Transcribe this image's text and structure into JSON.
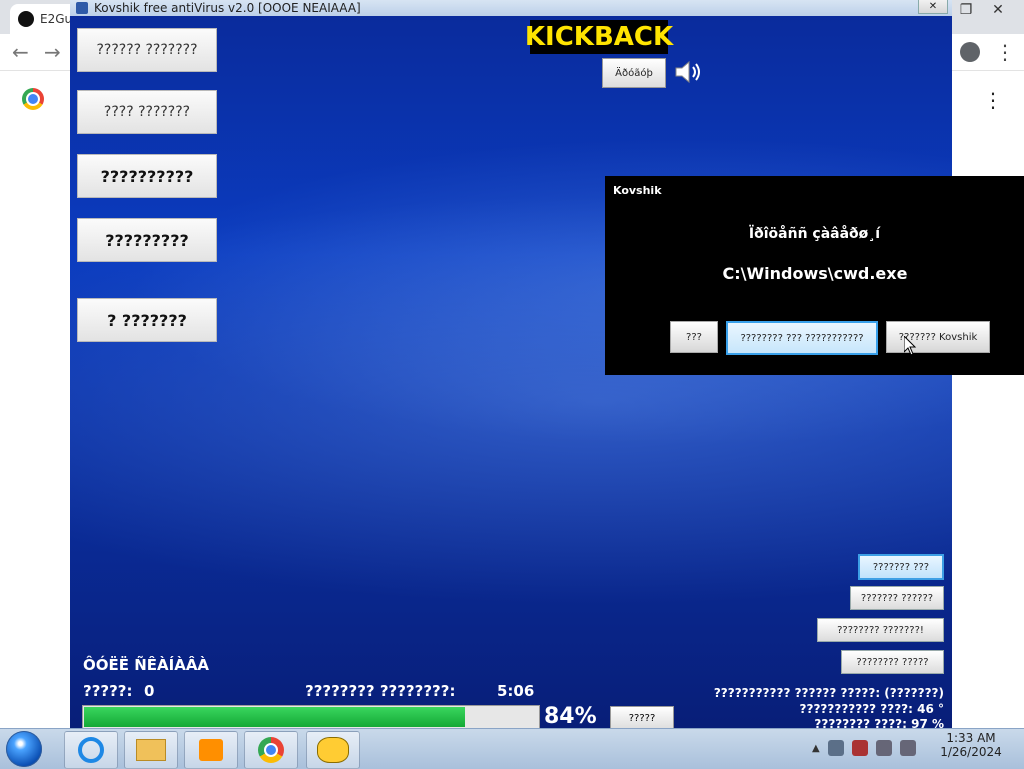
{
  "browser": {
    "tab_label": "E2Gu",
    "nav": {
      "back": "←",
      "forward": "→"
    }
  },
  "app": {
    "title": "Kovshik free antiVirus v2.0 [OOOE NEAIAAA]",
    "close_label": "✕",
    "menu_buttons": [
      "?????? ???????",
      "???? ???????",
      "??????????",
      "?????????",
      "? ???????"
    ],
    "kickback": "KICKBACK",
    "top_button_label": "Äðóãóþ",
    "right_buttons": [
      "??????? ???",
      "??????? ??????",
      "???????? ???????!",
      "???????? ?????"
    ],
    "status": {
      "title": "ÔÓËË ÑÊÀÍÀÂÀ",
      "files_label": "?????:",
      "files_value": "0",
      "time_label": "???????? ????????:",
      "time_value": "5:06",
      "progress_percent": 84,
      "percent_text": "84%",
      "small_button": "?????"
    },
    "stats": [
      "??????????? ?????? ?????: (???????)",
      "??????????? ????:  46   °",
      "???????? ????: 97   %"
    ]
  },
  "dialog": {
    "title": "Kovshik",
    "message": "Ïðîöåññ çàâåðø¸í",
    "path": "C:\\Windows\\cwd.exe",
    "buttons": [
      "???",
      "???????? ??? ???????????",
      "??????? Kovshik"
    ]
  },
  "taskbar": {
    "clock_time": "1:33 AM",
    "clock_date": "1/26/2024"
  }
}
